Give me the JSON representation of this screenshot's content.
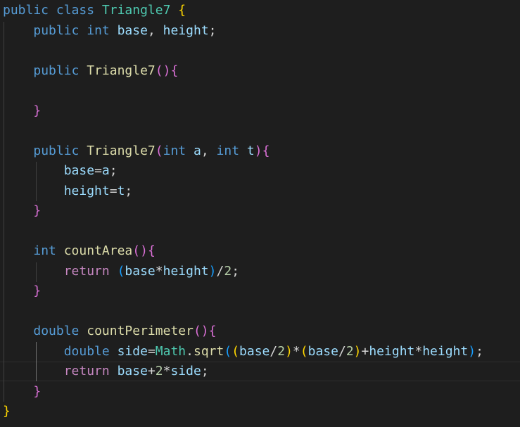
{
  "editor": {
    "language": "java",
    "theme_colors": {
      "background": "#1e1e1e",
      "keyword": "#569cd6",
      "class_name": "#4ec9b0",
      "function": "#dcdcaa",
      "variable": "#9cdcfe",
      "number": "#b5cea8",
      "control": "#c586c0",
      "bracket_level_1": "#ffd700",
      "bracket_level_2": "#da70d6",
      "bracket_level_3": "#179fff"
    },
    "lines": [
      [
        {
          "t": "public",
          "c": "kw"
        },
        {
          "t": " "
        },
        {
          "t": "class",
          "c": "kw"
        },
        {
          "t": " "
        },
        {
          "t": "Triangle7",
          "c": "cls"
        },
        {
          "t": " "
        },
        {
          "t": "{",
          "c": "b1"
        }
      ],
      [
        {
          "t": "    "
        },
        {
          "t": "public",
          "c": "kw"
        },
        {
          "t": " "
        },
        {
          "t": "int",
          "c": "kw"
        },
        {
          "t": " "
        },
        {
          "t": "base",
          "c": "var"
        },
        {
          "t": ", "
        },
        {
          "t": "height",
          "c": "var"
        },
        {
          "t": ";"
        }
      ],
      [
        {
          "t": ""
        }
      ],
      [
        {
          "t": "    "
        },
        {
          "t": "public",
          "c": "kw"
        },
        {
          "t": " "
        },
        {
          "t": "Triangle7",
          "c": "fn"
        },
        {
          "t": "(",
          "c": "b2"
        },
        {
          "t": ")",
          "c": "b2"
        },
        {
          "t": "{",
          "c": "b2"
        }
      ],
      [
        {
          "t": ""
        }
      ],
      [
        {
          "t": "    "
        },
        {
          "t": "}",
          "c": "b2"
        }
      ],
      [
        {
          "t": ""
        }
      ],
      [
        {
          "t": "    "
        },
        {
          "t": "public",
          "c": "kw"
        },
        {
          "t": " "
        },
        {
          "t": "Triangle7",
          "c": "fn"
        },
        {
          "t": "(",
          "c": "b2"
        },
        {
          "t": "int",
          "c": "kw"
        },
        {
          "t": " "
        },
        {
          "t": "a",
          "c": "var"
        },
        {
          "t": ", "
        },
        {
          "t": "int",
          "c": "kw"
        },
        {
          "t": " "
        },
        {
          "t": "t",
          "c": "var"
        },
        {
          "t": ")",
          "c": "b2"
        },
        {
          "t": "{",
          "c": "b2"
        }
      ],
      [
        {
          "t": "        "
        },
        {
          "t": "base",
          "c": "var"
        },
        {
          "t": "="
        },
        {
          "t": "a",
          "c": "var"
        },
        {
          "t": ";"
        }
      ],
      [
        {
          "t": "        "
        },
        {
          "t": "height",
          "c": "var"
        },
        {
          "t": "="
        },
        {
          "t": "t",
          "c": "var"
        },
        {
          "t": ";"
        }
      ],
      [
        {
          "t": "    "
        },
        {
          "t": "}",
          "c": "b2"
        }
      ],
      [
        {
          "t": ""
        }
      ],
      [
        {
          "t": "    "
        },
        {
          "t": "int",
          "c": "kw"
        },
        {
          "t": " "
        },
        {
          "t": "countArea",
          "c": "fn"
        },
        {
          "t": "(",
          "c": "b2"
        },
        {
          "t": ")",
          "c": "b2"
        },
        {
          "t": "{",
          "c": "b2"
        }
      ],
      [
        {
          "t": "        "
        },
        {
          "t": "return",
          "c": "ctl"
        },
        {
          "t": " "
        },
        {
          "t": "(",
          "c": "b3"
        },
        {
          "t": "base",
          "c": "var"
        },
        {
          "t": "*"
        },
        {
          "t": "height",
          "c": "var"
        },
        {
          "t": ")",
          "c": "b3"
        },
        {
          "t": "/"
        },
        {
          "t": "2",
          "c": "num"
        },
        {
          "t": ";"
        }
      ],
      [
        {
          "t": "    "
        },
        {
          "t": "}",
          "c": "b2"
        }
      ],
      [
        {
          "t": ""
        }
      ],
      [
        {
          "t": "    "
        },
        {
          "t": "double",
          "c": "kw"
        },
        {
          "t": " "
        },
        {
          "t": "countPerimeter",
          "c": "fn"
        },
        {
          "t": "(",
          "c": "b2"
        },
        {
          "t": ")",
          "c": "b2"
        },
        {
          "t": "{",
          "c": "b2"
        }
      ],
      [
        {
          "t": "        "
        },
        {
          "t": "double",
          "c": "kw"
        },
        {
          "t": " "
        },
        {
          "t": "side",
          "c": "var"
        },
        {
          "t": "="
        },
        {
          "t": "Math",
          "c": "cls"
        },
        {
          "t": "."
        },
        {
          "t": "sqrt",
          "c": "fn"
        },
        {
          "t": "(",
          "c": "b3"
        },
        {
          "t": "(",
          "c": "b1"
        },
        {
          "t": "base",
          "c": "var"
        },
        {
          "t": "/"
        },
        {
          "t": "2",
          "c": "num"
        },
        {
          "t": ")",
          "c": "b1"
        },
        {
          "t": "*"
        },
        {
          "t": "(",
          "c": "b1"
        },
        {
          "t": "base",
          "c": "var"
        },
        {
          "t": "/"
        },
        {
          "t": "2",
          "c": "num"
        },
        {
          "t": ")",
          "c": "b1"
        },
        {
          "t": "+"
        },
        {
          "t": "height",
          "c": "var"
        },
        {
          "t": "*"
        },
        {
          "t": "height",
          "c": "var"
        },
        {
          "t": ")",
          "c": "b3"
        },
        {
          "t": ";"
        }
      ],
      [
        {
          "t": "        "
        },
        {
          "t": "return",
          "c": "ctl"
        },
        {
          "t": " "
        },
        {
          "t": "base",
          "c": "var"
        },
        {
          "t": "+"
        },
        {
          "t": "2",
          "c": "num"
        },
        {
          "t": "*"
        },
        {
          "t": "side",
          "c": "var"
        },
        {
          "t": ";"
        }
      ],
      [
        {
          "t": "    "
        },
        {
          "t": "}",
          "c": "b2"
        }
      ],
      [
        {
          "t": "}",
          "c": "b1"
        }
      ]
    ]
  }
}
